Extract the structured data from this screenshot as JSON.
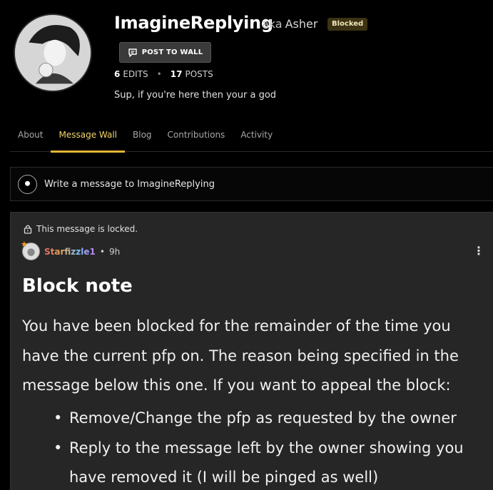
{
  "profile": {
    "username": "ImagineReplying",
    "aka_word": "aka",
    "aka_name": "Asher",
    "badge": "Blocked",
    "post_button": "POST TO WALL",
    "edits_count": "6",
    "edits_label": "EDITS",
    "posts_count": "17",
    "posts_label": "POSTS",
    "bio": "Sup, if you're here then your a god"
  },
  "tabs": [
    {
      "label": "About"
    },
    {
      "label": "Message Wall"
    },
    {
      "label": "Blog"
    },
    {
      "label": "Contributions"
    },
    {
      "label": "Activity"
    }
  ],
  "compose": {
    "prompt": "Write a message to ImagineReplying"
  },
  "message": {
    "locked_text": "This message is locked.",
    "author": "Starfizzle1",
    "separator": "•",
    "time": "9h",
    "more_icon": "⋮",
    "title": "Block note",
    "body": "You have been blocked for the remainder of the time you have the current pfp on. The reason being specified in the message below this one. If you want to appeal the block:",
    "bullets": [
      "Remove/Change the pfp as requested by the owner",
      "Reply to the message left by the owner showing you have removed it (I will be pinged as well)"
    ]
  }
}
